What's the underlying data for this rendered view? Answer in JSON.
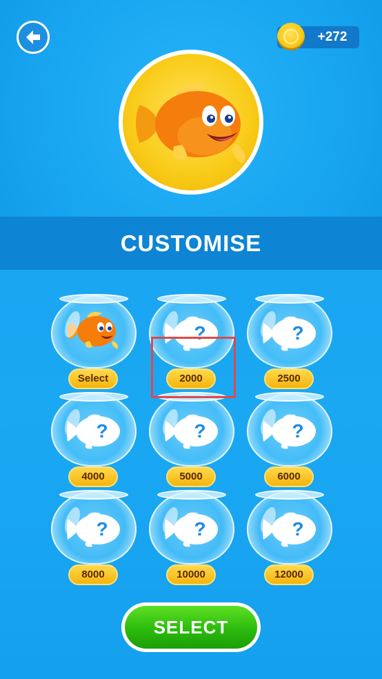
{
  "header": {
    "back_icon": "arrow-left-icon",
    "coins": "+272",
    "coin_icon": "coin-icon"
  },
  "avatar": {
    "icon": "goldfish-icon"
  },
  "banner": {
    "title": "CUSTOMISE"
  },
  "fish_items": [
    {
      "label": "Select",
      "unlocked": true
    },
    {
      "label": "2000",
      "unlocked": false
    },
    {
      "label": "2500",
      "unlocked": false
    },
    {
      "label": "4000",
      "unlocked": false
    },
    {
      "label": "5000",
      "unlocked": false
    },
    {
      "label": "6000",
      "unlocked": false
    },
    {
      "label": "8000",
      "unlocked": false
    },
    {
      "label": "10000",
      "unlocked": false
    },
    {
      "label": "12000",
      "unlocked": false
    }
  ],
  "footer": {
    "select_label": "SELECT"
  },
  "colors": {
    "background": "#1aa7f2",
    "banner": "#0d84d4",
    "price_tag": "#f6b40d",
    "select_button": "#2cbb0e",
    "highlight": "#e04848"
  }
}
